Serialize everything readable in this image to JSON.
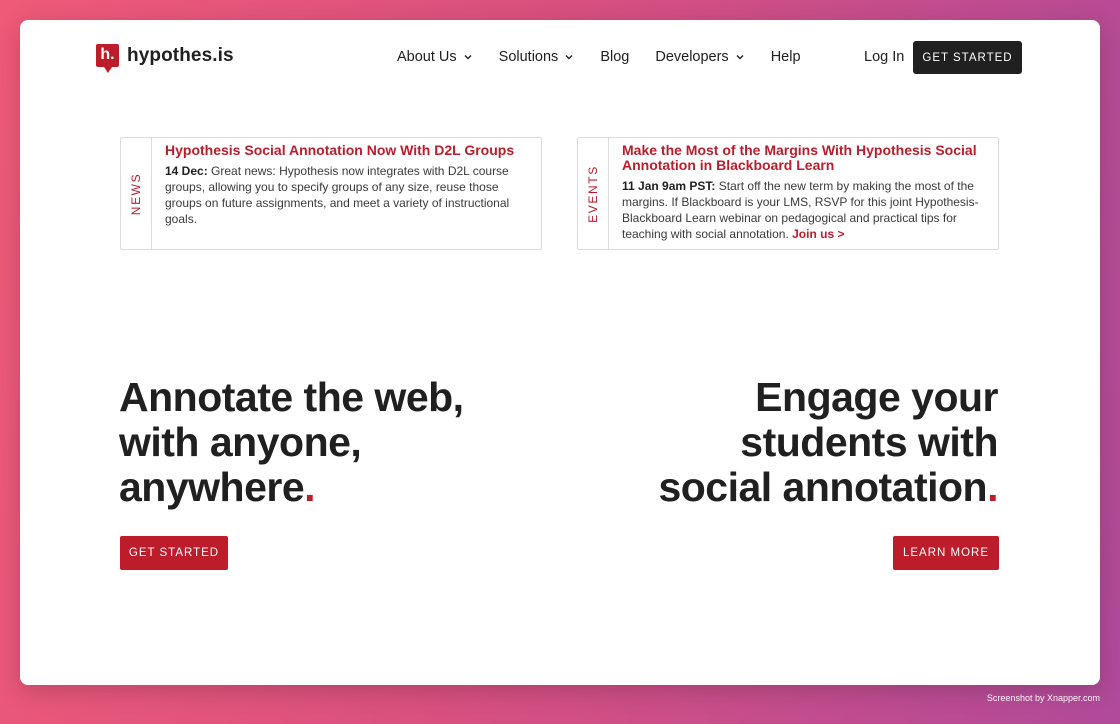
{
  "header": {
    "logo_letter": "h.",
    "logo_text": "hypothes.is",
    "nav": [
      {
        "label": "About Us",
        "dropdown": true
      },
      {
        "label": "Solutions",
        "dropdown": true
      },
      {
        "label": "Blog",
        "dropdown": false
      },
      {
        "label": "Developers",
        "dropdown": true
      },
      {
        "label": "Help",
        "dropdown": false
      }
    ],
    "login_label": "Log In",
    "cta_label": "GET STARTED"
  },
  "news": {
    "tag": "NEWS",
    "title": "Hypothesis Social Annotation Now With D2L Groups",
    "date": "14 Dec:",
    "body": " Great news: Hypothesis now integrates with D2L course groups, allowing you to specify groups of any size, reuse those groups on future assignments, and meet a variety of instructional goals."
  },
  "events": {
    "tag": "EVENTS",
    "title": "Make the Most of the Margins With Hypothesis Social Annotation in Blackboard Learn",
    "date": "11 Jan 9am PST:",
    "body": " Start off the new term by making the most of the margins. If Blackboard is your LMS, RSVP for this joint Hypothesis-Blackboard Learn webinar on pedagogical and practical tips for teaching with social annotation. ",
    "link": "Join us >"
  },
  "hero_left": {
    "lines": [
      "Annotate the web,",
      "with anyone,",
      "anywhere"
    ],
    "dot": ".",
    "button": "GET STARTED"
  },
  "hero_right": {
    "lines": [
      "Engage your",
      "students with",
      "social annotation"
    ],
    "dot": ".",
    "button": "LEARN MORE"
  },
  "credit": "Screenshot by Xnapper.com",
  "colors": {
    "brand": "#bd1c2b",
    "dark": "#202020"
  }
}
